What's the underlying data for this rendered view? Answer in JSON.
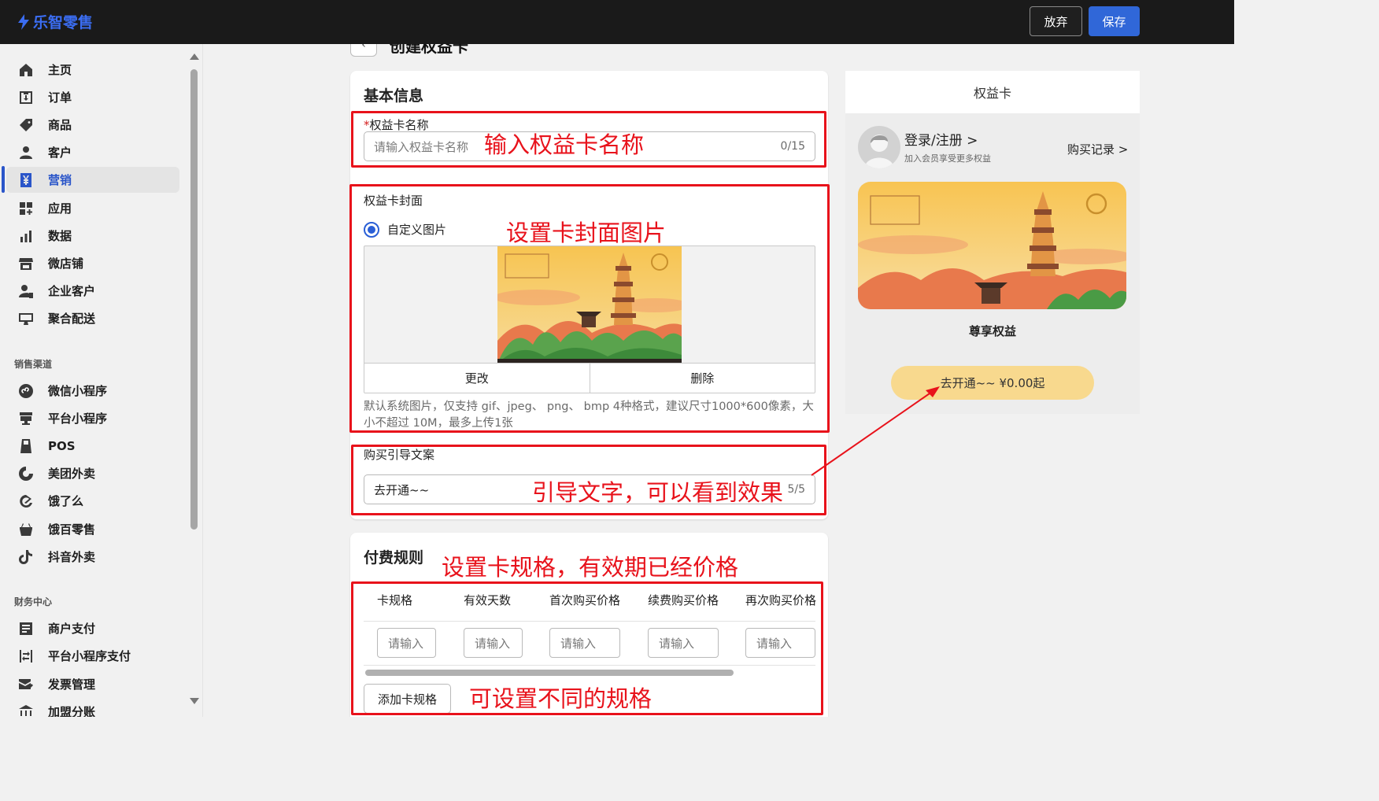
{
  "app": {
    "name": "乐智零售"
  },
  "topbar": {
    "discard_label": "放弃",
    "save_label": "保存"
  },
  "sidebar": {
    "items": [
      {
        "label": "主页",
        "icon": "home-icon"
      },
      {
        "label": "订单",
        "icon": "order-icon"
      },
      {
        "label": "商品",
        "icon": "tag-icon"
      },
      {
        "label": "客户",
        "icon": "person-icon"
      },
      {
        "label": "营销",
        "icon": "yen-icon",
        "active": true
      },
      {
        "label": "应用",
        "icon": "apps-icon"
      },
      {
        "label": "数据",
        "icon": "bar-chart-icon"
      },
      {
        "label": "微店铺",
        "icon": "store-icon"
      },
      {
        "label": "企业客户",
        "icon": "enterprise-user-icon"
      },
      {
        "label": "聚合配送",
        "icon": "delivery-icon"
      }
    ],
    "sales_channels": {
      "title": "销售渠道",
      "items": [
        {
          "label": "微信小程序",
          "icon": "miniprogram-icon"
        },
        {
          "label": "平台小程序",
          "icon": "platform-icon"
        },
        {
          "label": "POS",
          "icon": "pos-icon"
        },
        {
          "label": "美团外卖",
          "icon": "meituan-icon"
        },
        {
          "label": "饿了么",
          "icon": "eleme-icon"
        },
        {
          "label": "饿百零售",
          "icon": "basket-icon"
        },
        {
          "label": "抖音外卖",
          "icon": "douyin-icon"
        }
      ]
    },
    "finance": {
      "title": "财务中心",
      "items": [
        {
          "label": "商户支付",
          "icon": "document-icon"
        },
        {
          "label": "平台小程序支付",
          "icon": "transfer-icon"
        },
        {
          "label": "发票管理",
          "icon": "invoice-icon"
        },
        {
          "label": "加盟分账",
          "icon": "bank-icon"
        }
      ]
    }
  },
  "page": {
    "title": "创建权益卡",
    "back_icon": "chevron-left-icon"
  },
  "basic_info": {
    "title": "基本信息",
    "name_field": {
      "required_mark": "*",
      "label": "权益卡名称",
      "placeholder": "请输入权益卡名称",
      "counter": "0/15"
    },
    "cover": {
      "label": "权益卡封面",
      "radio_label": "自定义图片",
      "change_label": "更改",
      "delete_label": "删除",
      "help": "默认系统图片，仅支持 gif、jpeg、 png、 bmp 4种格式，建议尺寸1000*600像素，大小不超过 10M，最多上传1张"
    },
    "guide": {
      "label": "购买引导文案",
      "value": "去开通~~",
      "counter": "5/5"
    }
  },
  "pay_rules": {
    "title": "付费规则",
    "columns": [
      "卡规格",
      "有效天数",
      "首次购买价格",
      "续费购买价格",
      "再次购买价格"
    ],
    "input_placeholder": "请输入",
    "add_spec_label": "添加卡规格"
  },
  "annotations": {
    "name": "输入权益卡名称",
    "cover": "设置卡封面图片",
    "guide": "引导文字，可以看到效果",
    "rules": "设置卡规格，有效期已经价格",
    "specs": "可设置不同的规格"
  },
  "preview": {
    "title": "权益卡",
    "login": "登录/注册 >",
    "login_sub": "加入会员享受更多权益",
    "records": "购买记录 >",
    "benefit_title": "尊享权益",
    "open_button": "去开通~~  ¥0.00起"
  },
  "colors": {
    "accent": "#3067d8",
    "annotation": "#e8121b",
    "open_button": "#f8d98e",
    "topbar": "#1a1a1a"
  }
}
